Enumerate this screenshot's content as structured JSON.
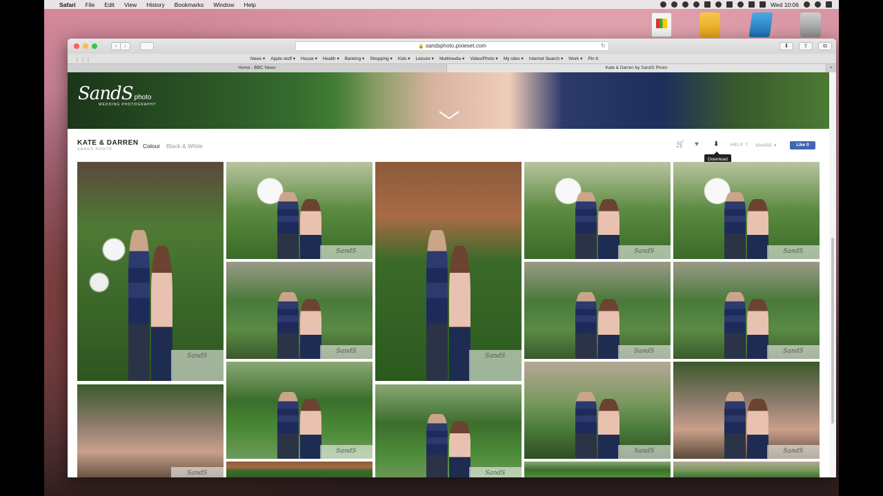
{
  "menubar": {
    "app": "Safari",
    "items": [
      "File",
      "Edit",
      "View",
      "History",
      "Bookmarks",
      "Window",
      "Help"
    ],
    "clock": "Wed 10:06"
  },
  "browser": {
    "url": "sandsphoto.pixieset.com",
    "bookmarks": [
      "News ▾",
      "Apple stuff ▾",
      "House ▾",
      "Health ▾",
      "Banking ▾",
      "Shopping ▾",
      "Kids ▾",
      "Leisure ▾",
      "Multimedia ▾",
      "Video/Photo ▾",
      "My sites ▾",
      "Internet Search ▾",
      "Work ▾",
      "Pin It"
    ],
    "tabs": [
      "Home - BBC News",
      "Kate & Darren by SandS Photo"
    ]
  },
  "logo": {
    "main": "SandS",
    "photo": "photo",
    "sub": "WEDDING PHOTOGRAPHY"
  },
  "gallery": {
    "title": "KATE & DARREN",
    "subtitle": "SANDS PHOTO",
    "sets": [
      "Colour",
      "Black & White"
    ],
    "help": "HELP ?",
    "share": "SHARE ▾",
    "fb_like": "Like 0",
    "tooltip": "Download",
    "watermark": "SandS"
  },
  "icons": {
    "cart": "cart-icon",
    "heart": "heart-icon",
    "download": "download-icon"
  }
}
